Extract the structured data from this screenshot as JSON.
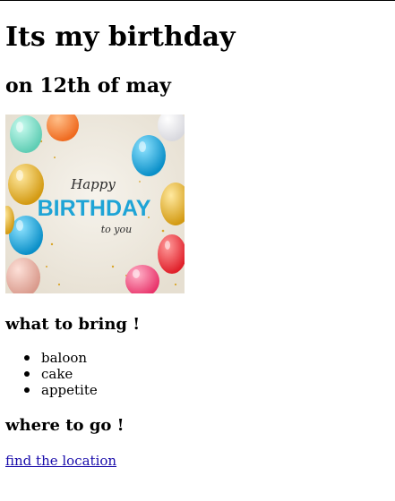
{
  "title": "Its my birthday",
  "subtitle": "on 12th of may",
  "hero_image": {
    "line1": "Happy",
    "line2": "BIRTHDAY",
    "line3": "to you",
    "colors": {
      "background": "#efeae0",
      "accent_text": "#1ea4d6",
      "script_text": "#2b2b2b"
    }
  },
  "bring": {
    "heading": "what to bring !",
    "items": [
      "baloon",
      "cake",
      "appetite"
    ]
  },
  "go": {
    "heading": "where to go !",
    "link_text": "find the location",
    "link_color": "#1a0dab"
  }
}
